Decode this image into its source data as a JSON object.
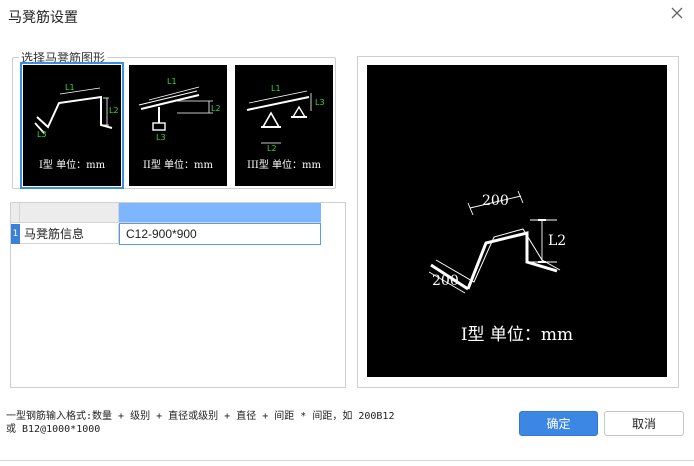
{
  "window": {
    "title": "马凳筋设置",
    "close_icon": "close-icon"
  },
  "shape_group": {
    "legend": "选择马凳筋图形"
  },
  "thumbnails": [
    {
      "caption": "I型 单位：mm",
      "l1": "L1",
      "l2": "L2",
      "l3": "L3",
      "selected": true
    },
    {
      "caption": "II型 单位：mm",
      "l1": "L1",
      "l2": "L2",
      "l3": "L3",
      "selected": false
    },
    {
      "caption": "III型 单位：mm",
      "l1": "L1",
      "l2": "L2",
      "l3": "L3",
      "selected": false
    }
  ],
  "grid": {
    "row_number": "1",
    "row_label": "马凳筋信息",
    "row_value": "C12-900*900"
  },
  "preview": {
    "top_dim": "200",
    "right_dim": "L2",
    "bottom_dim": "200",
    "caption": "I型 单位：mm"
  },
  "hint": {
    "line1": "一型钢筋输入格式:数量 + 级别 + 直径或级别 + 直径 + 间距 * 间距，如 200B12",
    "line2": "或 B12@1000*1000"
  },
  "buttons": {
    "ok": "确定",
    "cancel": "取消"
  },
  "colors": {
    "accent": "#3d87e4",
    "dimension_green": "#33dd33",
    "selected_cell": "#7db5ff"
  }
}
